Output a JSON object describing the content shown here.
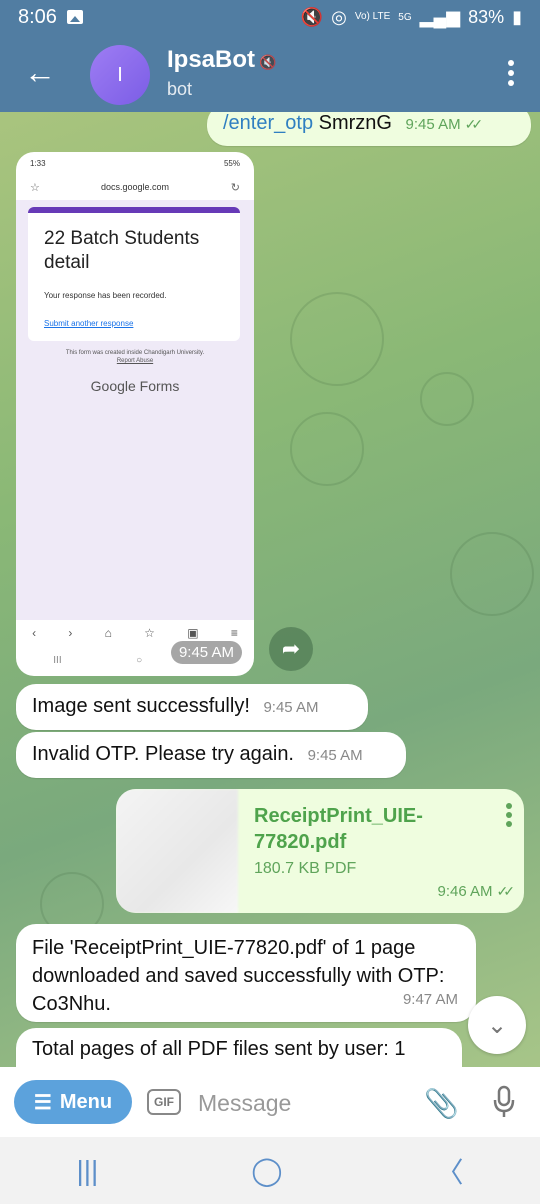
{
  "status_bar": {
    "time": "8:06",
    "battery": "83%",
    "net": "Vo) LTE",
    "fiveg": "5G"
  },
  "header": {
    "avatar_letter": "I",
    "title": "IpsaBot",
    "subtitle": "bot"
  },
  "messages": {
    "first": {
      "command": "/enter_otp",
      "code": "SmrznG",
      "time": "9:45 AM"
    },
    "screenshot": {
      "time": "9:45 AM",
      "phone_time": "1:33",
      "phone_battery": "55%",
      "url": "docs.google.com",
      "form_title": "22 Batch Students detail",
      "recorded": "Your response has been recorded.",
      "submit_another": "Submit another response",
      "created_inside": "This form was created inside Chandigarh University.",
      "report_abuse": "Report Abuse",
      "brand": "Google Forms"
    },
    "image_sent": {
      "text": "Image sent successfully!",
      "time": "9:45 AM"
    },
    "invalid_otp": {
      "text": "Invalid OTP. Please try again.",
      "time": "9:45 AM"
    },
    "pdf": {
      "name": "ReceiptPrint_UIE-77820.pdf",
      "size": "180.7 KB PDF",
      "time": "9:46 AM"
    },
    "download": {
      "text": "File 'ReceiptPrint_UIE-77820.pdf' of 1 page downloaded and saved successfully with OTP: Co3Nhu.",
      "time": "9:47 AM"
    },
    "total": {
      "text": "Total pages of all PDF files sent by user: 1"
    }
  },
  "input_bar": {
    "menu_label": "Menu",
    "gif_label": "GIF",
    "placeholder": "Message"
  }
}
